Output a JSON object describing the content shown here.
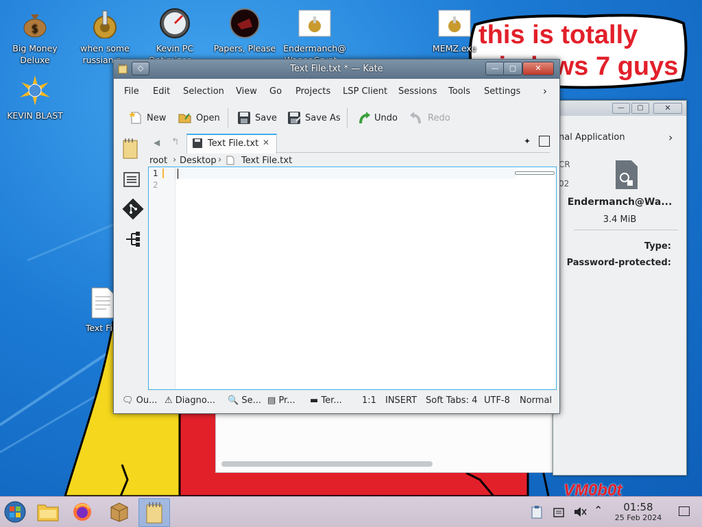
{
  "desktop": {
    "icons": [
      {
        "label": "Big Money\nDeluxe",
        "icon": "money-bag-icon"
      },
      {
        "label": "when some\nrussian r...",
        "icon": "gear-icon"
      },
      {
        "label": "Kevin PC\nOptimizer ...",
        "icon": "speedometer-icon"
      },
      {
        "label": "Papers, Please",
        "icon": "papers-please-icon"
      },
      {
        "label": "Endermanch@\nWannaCrypt...",
        "icon": "gear-document-icon"
      },
      {
        "label": "MEMZ.exe",
        "icon": "gear-document-icon"
      },
      {
        "label": "KEVIN BLAST",
        "icon": "kevin-blast-icon"
      },
      {
        "label": "Text File",
        "icon": "text-file-icon"
      }
    ],
    "bubble_text_line1": "this is totally",
    "bubble_text_line2": "windows 7 guys",
    "watermark": "VM0b0t"
  },
  "bg_window": {
    "header": "nal Application",
    "file_name": "Endermanch@Wa...",
    "file_size": "3.4 MiB",
    "type_label": "Type:",
    "password_label": "Password-protected:",
    "peek_line1": "CR",
    "peek_line2": "02"
  },
  "kate": {
    "title": "Text File.txt * — Kate",
    "menu": [
      "File",
      "Edit",
      "Selection",
      "View",
      "Go",
      "Projects",
      "LSP Client",
      "Sessions",
      "Tools",
      "Settings"
    ],
    "toolbar": {
      "new": "New",
      "open": "Open",
      "save": "Save",
      "save_as": "Save As",
      "undo": "Undo",
      "redo": "Redo"
    },
    "tab_label": "Text File.txt",
    "breadcrumb": [
      "root",
      "Desktop",
      "Text File.txt"
    ],
    "line_numbers": [
      "1",
      "2"
    ],
    "status": {
      "output": "Ou...",
      "diagnostics": "Diagno...",
      "search": "Se...",
      "projects": "Pr...",
      "terminal": "Ter...",
      "cursor": "1:1",
      "mode": "INSERT",
      "tabs": "Soft Tabs: 4",
      "encoding": "UTF-8",
      "syntax": "Normal"
    }
  },
  "taskbar": {
    "time": "01:58",
    "date": "25 Feb 2024"
  }
}
